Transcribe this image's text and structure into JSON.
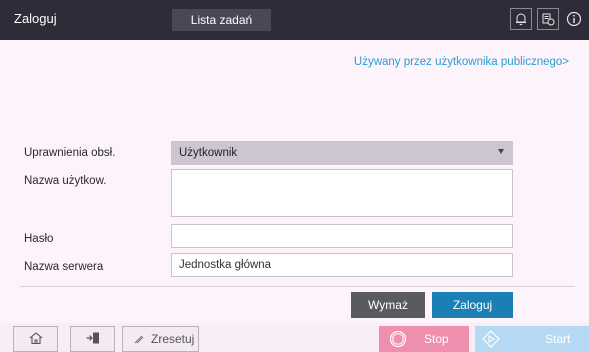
{
  "header": {
    "title": "Zaloguj",
    "job_list_tab": "Lista zadań",
    "icons": [
      "bell-icon",
      "device-status-icon",
      "info-icon"
    ]
  },
  "public_user_link": "Używany przez użytkownika publicznego>",
  "form": {
    "permissions_label": "Uprawnienia obsł.",
    "permissions_value": "Użytkownik",
    "username_label": "Nazwa użytkow.",
    "username_value": "",
    "password_label": "Hasło",
    "password_value": "",
    "server_label": "Nazwa serwera",
    "server_value": "Jednostka główna"
  },
  "actions": {
    "clear": "Wymaż",
    "login": "Zaloguj"
  },
  "bottom_bar": {
    "reset": "Zresetuj",
    "stop": "Stop",
    "start": "Start"
  },
  "colors": {
    "header_bg": "#2e2c38",
    "link": "#2d9bd1",
    "login_button": "#1a7fb4",
    "stop_button": "#ee8fae",
    "start_button": "#b5d9f2"
  }
}
